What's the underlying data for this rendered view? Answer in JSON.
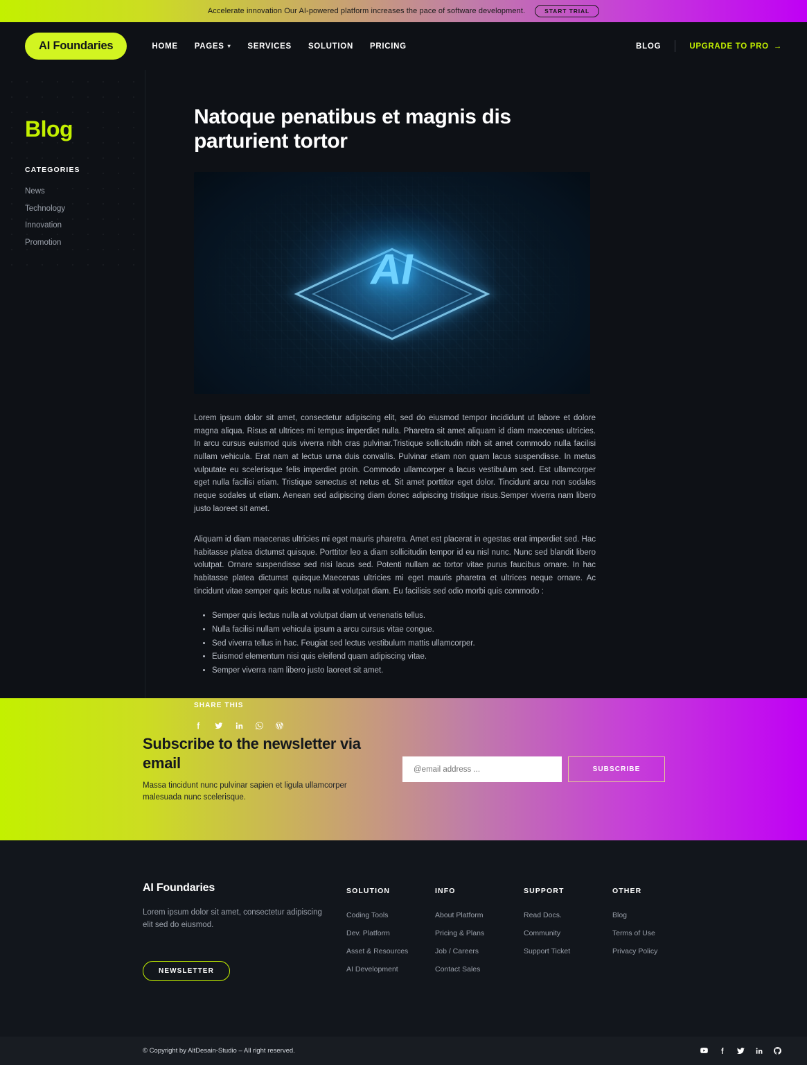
{
  "topbar": {
    "text": "Accelerate innovation Our AI-powered platform increases the pace of software development.",
    "cta": "START TRIAL"
  },
  "header": {
    "logo": "AI Foundaries",
    "nav": [
      {
        "label": "HOME",
        "caret": false
      },
      {
        "label": "PAGES",
        "caret": true
      },
      {
        "label": "SERVICES",
        "caret": false
      },
      {
        "label": "SOLUTION",
        "caret": false
      },
      {
        "label": "PRICING",
        "caret": false
      }
    ],
    "blog_link": "BLOG",
    "upgrade": "UPGRADE TO PRO",
    "upgrade_arrow": "→"
  },
  "sidebar": {
    "title": "Blog",
    "categories_heading": "CATEGORIES",
    "categories": [
      "News",
      "Technology",
      "Innovation",
      "Promotion"
    ]
  },
  "article": {
    "title": "Natoque penatibus et magnis dis parturient tortor",
    "hero_alt": "ai-chip-circuit-board-image",
    "hero_label": "AI",
    "paragraph1": "Lorem ipsum dolor sit amet, consectetur adipiscing elit, sed do eiusmod tempor incididunt ut labore et dolore magna aliqua. Risus at ultrices mi tempus imperdiet nulla. Pharetra sit amet aliquam id diam maecenas ultricies. In arcu cursus euismod quis viverra nibh cras pulvinar.Tristique sollicitudin nibh sit amet commodo nulla facilisi nullam vehicula. Erat nam at lectus urna duis convallis. Pulvinar etiam non quam lacus suspendisse. In metus vulputate eu scelerisque felis imperdiet proin. Commodo ullamcorper a lacus vestibulum sed. Est ullamcorper eget nulla facilisi etiam. Tristique senectus et netus et. Sit amet porttitor eget dolor. Tincidunt arcu non sodales neque sodales ut etiam. Aenean sed adipiscing diam donec adipiscing tristique risus.Semper viverra nam libero justo laoreet sit amet.",
    "paragraph2": "Aliquam id diam maecenas ultricies mi eget mauris pharetra. Amet est placerat in egestas erat imperdiet sed. Hac habitasse platea dictumst quisque. Porttitor leo a diam sollicitudin tempor id eu nisl nunc. Nunc sed blandit libero volutpat. Ornare suspendisse sed nisi lacus sed. Potenti nullam ac tortor vitae purus faucibus ornare. In hac habitasse platea dictumst quisque.Maecenas ultricies mi eget mauris pharetra et ultrices neque ornare. Ac tincidunt vitae semper quis lectus nulla at volutpat diam. Eu facilisis sed odio morbi quis commodo :",
    "bullets": [
      "Semper quis lectus nulla at volutpat diam ut venenatis tellus.",
      "Nulla facilisi nullam vehicula ipsum a arcu cursus vitae congue.",
      "Sed viverra tellus in hac. Feugiat sed lectus vestibulum mattis ullamcorper.",
      "Euismod elementum nisi quis eleifend quam adipiscing vitae.",
      "Semper viverra nam libero justo laoreet sit amet."
    ],
    "share_heading": "SHARE THIS",
    "share_icons": [
      "facebook-icon",
      "twitter-icon",
      "linkedin-icon",
      "whatsapp-icon",
      "wordpress-icon"
    ]
  },
  "newsletter": {
    "title": "Subscribe to the newsletter via email",
    "subtitle": "Massa tincidunt nunc pulvinar sapien et ligula ullamcorper malesuada nunc scelerisque.",
    "input_placeholder": "@email address ...",
    "input_value": "",
    "button": "SUBSCRIBE"
  },
  "footer": {
    "brand": "AI Foundaries",
    "brand_text": "Lorem ipsum dolor sit amet, consectetur adipiscing elit sed do eiusmod.",
    "newsletter_button": "NEWSLETTER",
    "columns": [
      {
        "heading": "SOLUTION",
        "links": [
          "Coding Tools",
          "Dev. Platform",
          "Asset & Resources",
          "AI Development"
        ]
      },
      {
        "heading": "INFO",
        "links": [
          "About Platform",
          "Pricing & Plans",
          "Job / Careers",
          "Contact Sales"
        ]
      },
      {
        "heading": "SUPPORT",
        "links": [
          "Read Docs.",
          "Community",
          "Support Ticket"
        ]
      },
      {
        "heading": "OTHER",
        "links": [
          "Blog",
          "Terms of Use",
          "Privacy Policy"
        ]
      }
    ]
  },
  "copyright": {
    "text": "© Copyright by AltDesain-Studio – All right reserved.",
    "social_icons": [
      "youtube-icon",
      "facebook-icon",
      "twitter-icon",
      "linkedin-icon",
      "github-icon"
    ]
  },
  "colors": {
    "accent_lime": "#c3f000",
    "accent_magenta": "#c000f5",
    "background_dark": "#0e1116",
    "footer_dark": "#12161c",
    "copyright_dark": "#181c22"
  }
}
